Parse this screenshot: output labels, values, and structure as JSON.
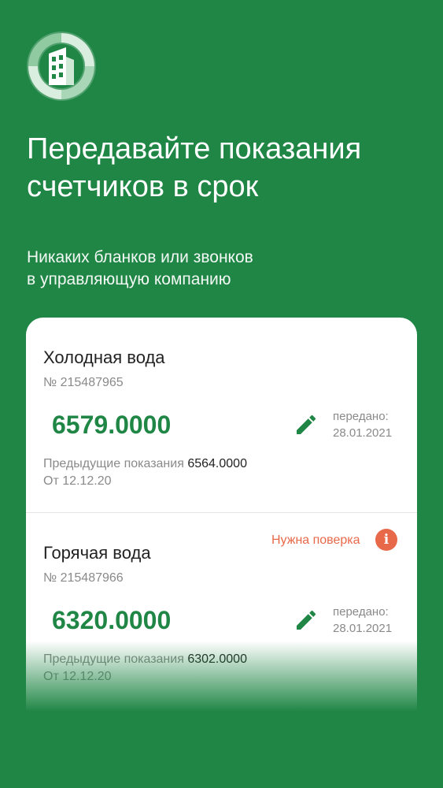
{
  "hero": {
    "logo_icon": "building-ring-logo",
    "headline_line1": "Передавайте показания",
    "headline_line2": "счетчиков в срок",
    "sub_line1": "Никаких бланков или звонков",
    "sub_line2": "в управляющую компанию"
  },
  "meters": [
    {
      "title": "Холодная вода",
      "number": "№ 215487965",
      "value": "6579.0000",
      "sent_label": "передано:",
      "sent_date": "28.01.2021",
      "prev_label": "Предыдущие показания",
      "prev_value": "6564.0000",
      "prev_date": "От 12.12.20"
    },
    {
      "title": "Горячая вода",
      "number": "№ 215487966",
      "value": "6320.0000",
      "sent_label": "передано:",
      "sent_date": "28.01.2021",
      "prev_label": "Предыдущие показания",
      "prev_value": "6302.0000",
      "prev_date": "От 12.12.20",
      "warning": "Нужна поверка",
      "warning_icon": "i"
    }
  ],
  "colors": {
    "brand_green": "#1f8645",
    "warning": "#e8694a"
  }
}
